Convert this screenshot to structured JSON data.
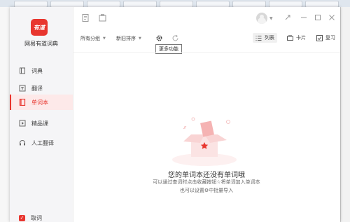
{
  "colors": {
    "brand": "#e8362f",
    "active_bg": "#fde9e9",
    "sidebar_bg": "#f5f5f7"
  },
  "app": {
    "logo_text": "有道",
    "name": "网易有道词典"
  },
  "sidebar": {
    "items": [
      {
        "label": "词典",
        "icon": "book-icon"
      },
      {
        "label": "翻译",
        "icon": "translate-icon"
      },
      {
        "label": "单词本",
        "icon": "wordbook-icon",
        "active": true
      },
      {
        "label": "精品课",
        "icon": "play-icon"
      },
      {
        "label": "人工翻译",
        "icon": "headset-icon"
      }
    ],
    "bottom_check_label": "取词"
  },
  "toolbar": {
    "group_dropdown": "所有分组",
    "sort_dropdown": "新旧排序",
    "settings_tooltip": "更多功能",
    "views": [
      {
        "label": "列表",
        "icon": "list-icon",
        "selected": true
      },
      {
        "label": "卡片",
        "icon": "card-icon"
      },
      {
        "label": "复习",
        "icon": "review-icon"
      }
    ]
  },
  "empty_state": {
    "title": "您的单词本还没有单词哦",
    "line1": "可以通过查词时点击收藏按钮☆将单词加入单词本",
    "line2": "也可以设置⚙中批量导入"
  }
}
